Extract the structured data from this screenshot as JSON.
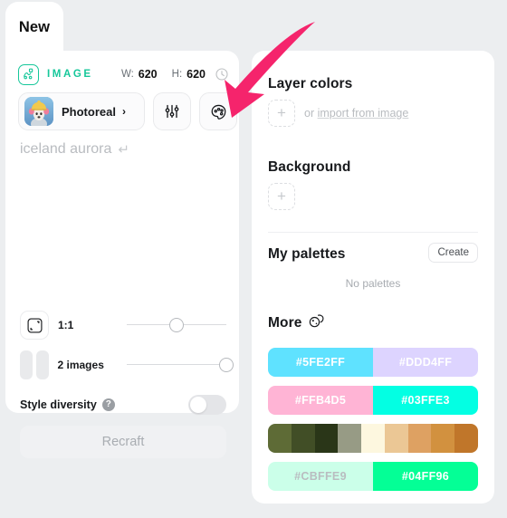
{
  "tab": {
    "label": "New"
  },
  "left": {
    "type_label": "IMAGE",
    "type_icon": "image-node-icon",
    "width_key": "W:",
    "width_value": "620",
    "height_key": "H:",
    "height_value": "620",
    "history_icon": "clock-icon",
    "model": {
      "name": "Photoreal",
      "chevron": "›",
      "thumb_icon": "dog-thumbnail"
    },
    "settings_icon": "sliders-icon",
    "palette_icon": "palette-icon",
    "prompt": {
      "value": "",
      "placeholder": "iceland aurora",
      "enter_glyph": "↵"
    },
    "aspect": {
      "label": "1:1",
      "icon": "crop-frame-icon",
      "slider_percent": 50
    },
    "count": {
      "label": "2 images",
      "icon": "two-images-icon",
      "slider_percent": 100
    },
    "style_diversity": {
      "label": "Style diversity",
      "help_icon": "question-mark-icon",
      "state": "off"
    },
    "recraft_button": {
      "label": "Recraft",
      "disabled": true
    }
  },
  "right": {
    "layer_colors": {
      "title": "Layer colors",
      "add_icon": "plus-icon",
      "or_text": "or ",
      "import_link": "import from image"
    },
    "background": {
      "title": "Background",
      "add_icon": "plus-icon"
    },
    "my_palettes": {
      "title": "My palettes",
      "create_label": "Create",
      "empty_text": "No palettes"
    },
    "more": {
      "title": "More",
      "icon": "dice-icon"
    },
    "palettes": [
      {
        "name": "palette-blue-lavender",
        "segments": [
          {
            "hex": "#5FE2FF",
            "label": "#5FE2FF",
            "text_color": "#ffffff"
          },
          {
            "hex": "#DDD4FF",
            "label": "#DDD4FF",
            "text_color": "#ffffff"
          }
        ]
      },
      {
        "name": "palette-pink-aqua",
        "segments": [
          {
            "hex": "#FFB4D5",
            "label": "#FFB4D5",
            "text_color": "#ffffff"
          },
          {
            "hex": "#03FFE3",
            "label": "#03FFE3",
            "text_color": "#ffffff"
          }
        ]
      },
      {
        "name": "palette-olive-tan",
        "segments": [
          {
            "hex": "#5E6B36",
            "label": "",
            "text_color": "#ffffff"
          },
          {
            "hex": "#414E26",
            "label": "",
            "text_color": "#ffffff"
          },
          {
            "hex": "#2A3618",
            "label": "",
            "text_color": "#ffffff"
          },
          {
            "hex": "#979B85",
            "label": "",
            "text_color": "#ffffff"
          },
          {
            "hex": "#FDF7DF",
            "label": "",
            "text_color": "#ffffff"
          },
          {
            "hex": "#EBC795",
            "label": "",
            "text_color": "#ffffff"
          },
          {
            "hex": "#DEA162",
            "label": "",
            "text_color": "#ffffff"
          },
          {
            "hex": "#D2913F",
            "label": "",
            "text_color": "#ffffff"
          },
          {
            "hex": "#C0762A",
            "label": "",
            "text_color": "#ffffff"
          }
        ]
      },
      {
        "name": "palette-mint-green",
        "segments": [
          {
            "hex": "#CBFFE9",
            "label": "#CBFFE9",
            "text_color": "#b9bcc0"
          },
          {
            "hex": "#04FF96",
            "label": "#04FF96",
            "text_color": "#ffffff"
          }
        ]
      }
    ]
  },
  "annotation": {
    "arrow_icon": "pointer-arrow-icon",
    "color": "#F5246C"
  },
  "theme": {
    "accent": "#16c79a",
    "page_bg": "#eceef0",
    "panel_bg": "#ffffff"
  }
}
